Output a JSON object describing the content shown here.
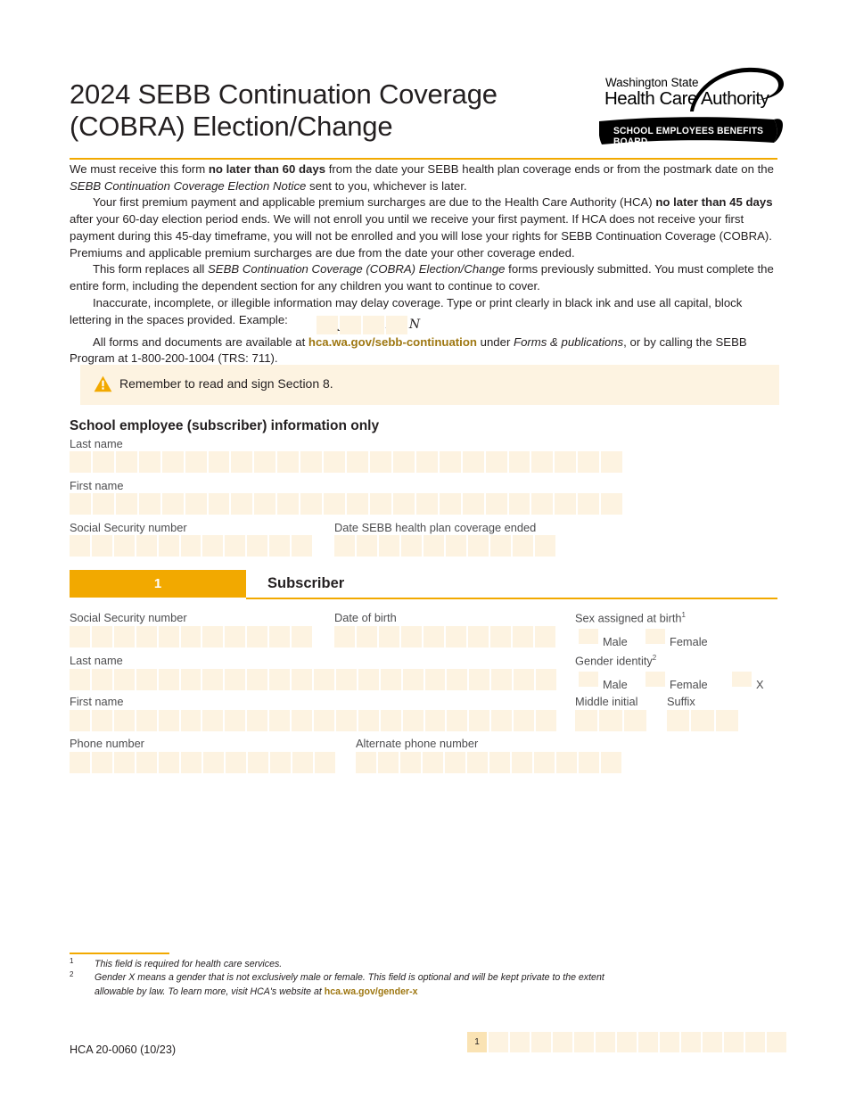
{
  "document": {
    "title_line1": "2024 SEBB Continuation Coverage",
    "title_line2": "(COBRA) Election/Change"
  },
  "logo": {
    "org_line1": "Washington State",
    "org_line2": "Health Care Authority",
    "banner": "SCHOOL EMPLOYEES BENEFITS BOARD"
  },
  "colors": {
    "accent_orange": "#f2a900",
    "field_cream": "#fdf3e1",
    "page_active": "#fae3b4",
    "gold_link": "#9e7711"
  },
  "intro": {
    "p1_a": "We must receive this form ",
    "p1_b": "no later than 60 days",
    "p1_c": " from the date your SEBB health plan coverage ends or from the postmark date on the ",
    "p1_d": "SEBB Continuation Coverage Election Notice",
    "p1_e": " sent to you, whichever is later.",
    "p2_a": "Your first premium payment and applicable premium surcharges are due to the Health Care Authority (HCA) ",
    "p2_b": "no later than 45 days",
    "p2_c": " after your 60-day election period ends. We will not enroll you until we receive your first payment. If HCA does not receive your first payment during this 45-day timeframe, you will not be enrolled and you will lose your rights for SEBB Continuation Coverage (COBRA). Premiums and applicable premium surcharges are due from the date your other coverage ended.",
    "p3_a": "This form replaces all ",
    "p3_b": "SEBB Continuation Coverage (COBRA) Election/Change",
    "p3_c": " forms previously submitted. You must complete the entire form, including the dependent section for any children you want to continue to cover.",
    "p4_a": "Inaccurate, incomplete, or illegible information may delay coverage. Type or print clearly in black ink and use all capital, block lettering in the spaces provided. Example:",
    "p4_example": [
      "J",
      "O",
      "H",
      "N"
    ],
    "p5_a": "All forms and documents are available at ",
    "p5_b": "hca.wa.gov/sebb-continuation",
    "p5_c": " under ",
    "p5_d": "Forms & publications",
    "p5_e": ", or by calling the SEBB Program at 1-800-200-1004 (TRS: 711)."
  },
  "note": {
    "icon": "warning-triangle-icon",
    "text": "Remember to read and sign Section 8."
  },
  "employee_section": {
    "heading": "School employee (subscriber) information only",
    "fields": [
      {
        "label": "Last name",
        "boxes": 24
      },
      {
        "label": "First name",
        "boxes": 24
      },
      {
        "label": "Social Security number",
        "boxes": 11
      },
      {
        "label": "Date SEBB health plan coverage ended",
        "boxes": 10
      }
    ]
  },
  "section1": {
    "number": "1",
    "name": "Subscriber",
    "ssn_label": "Social Security number",
    "ssn_boxes": 11,
    "dob_label": "Date of birth",
    "dob_boxes": 10,
    "sex_label": "Sex assigned at birth",
    "sex_footnote": "1",
    "sex_options": [
      "Male",
      "Female"
    ],
    "last_name_label": "Last name",
    "last_name_boxes": 22,
    "gender_label": "Gender identity",
    "gender_footnote": "2",
    "gender_options": [
      "Male",
      "Female",
      "X"
    ],
    "first_name_label": "First name",
    "first_name_boxes": 22,
    "middle_initial_label": "Middle initial",
    "middle_initial_boxes": 3,
    "suffix_label": "Suffix",
    "suffix_boxes": 3,
    "phone_label": "Phone number",
    "phone_boxes": 12,
    "alt_phone_label": "Alternate phone number",
    "alt_phone_boxes": 12
  },
  "footnotes": [
    {
      "marker": "1",
      "text": "This field is required for health care services."
    },
    {
      "marker": "2",
      "text_a": "Gender X means a gender that is not exclusively male or female. This field is optional and will be kept private to the extent allowable by law. To learn more, visit HCA's website at ",
      "link": "hca.wa.gov/gender-x"
    }
  ],
  "footer": {
    "form_id": "HCA 20-0060 (10/23)",
    "page_number": "1",
    "page_cells": 15
  }
}
